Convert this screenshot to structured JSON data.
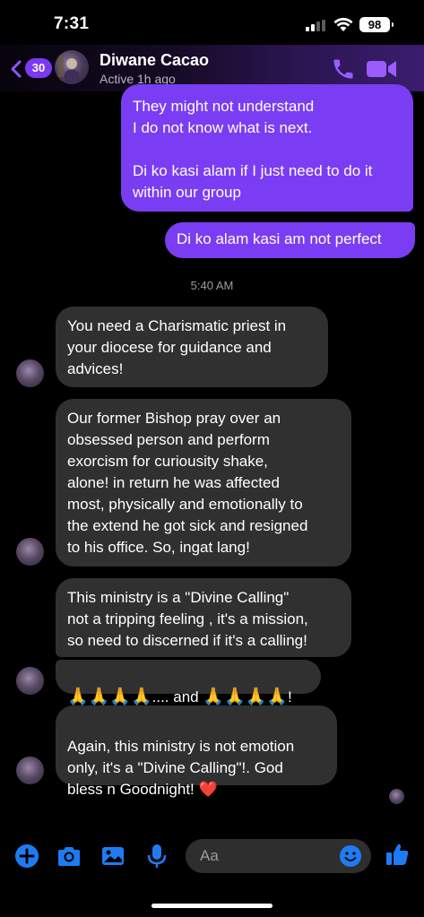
{
  "status_bar": {
    "time": "7:31",
    "battery": "98"
  },
  "header": {
    "unread_count": "30",
    "contact_name": "Diwane Cacao",
    "contact_status": "Active 1h ago"
  },
  "messages": [
    {
      "direction": "outgoing",
      "text": "They might not understand\nI do not know what is next.\n\nDi ko kasi alam if I just need to do it\nwithin our group"
    },
    {
      "direction": "outgoing",
      "text": "Di ko alam kasi am not perfect"
    },
    {
      "type": "timestamp",
      "text": "5:40 AM"
    },
    {
      "direction": "incoming",
      "text": "You need a Charismatic priest in\nyour diocese for guidance and\nadvices!"
    },
    {
      "direction": "incoming",
      "text": "Our former Bishop pray over an\nobsessed person and perform\nexorcism for curiousity shake,\nalone!  in return he was affected\nmost, physically and emotionally to\nthe extend he got sick and resigned\nto his office. So, ingat lang!"
    },
    {
      "direction": "incoming",
      "text": "This ministry is a \"Divine Calling\"\nnot a tripping feeling , it's a mission,\nso need to discerned if it's a calling!"
    },
    {
      "direction": "incoming",
      "emoji_left": "🙏🙏🙏🙏",
      "text_middle": ".... and ",
      "emoji_right": "🙏🙏🙏🙏",
      "text_end": "!"
    },
    {
      "direction": "incoming",
      "text": "Again, this ministry is not emotion\nonly, it's a \"Divine Calling\"!. God\nbless n Goodnight! ",
      "emoji_end": "❤️"
    }
  ],
  "composer": {
    "placeholder": "Aa"
  },
  "colors": {
    "accent": "#7a3df3",
    "icon_blue": "#1f7bf2",
    "incoming_bubble": "#303030"
  },
  "icons": [
    "back-chevron-icon",
    "phone-icon",
    "video-camera-icon",
    "plus-icon",
    "camera-icon",
    "photo-icon",
    "microphone-icon",
    "emoji-icon",
    "thumbs-up-icon"
  ]
}
